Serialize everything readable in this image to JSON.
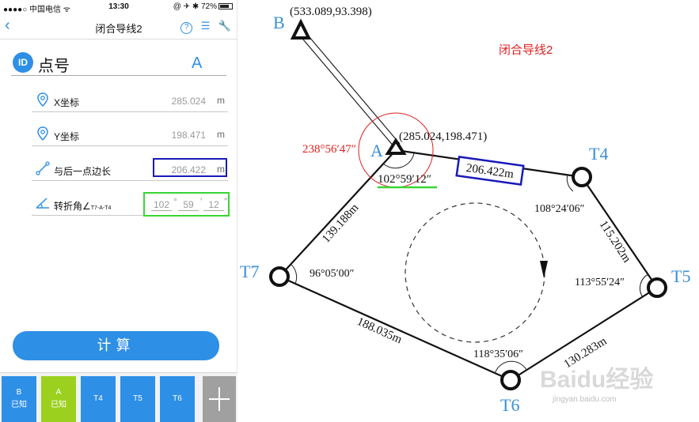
{
  "status": {
    "carrier": "●●●●○ 中国电信 ᯤ",
    "time": "13:30",
    "right": "@ ✈ ✱ 72%",
    "battery_level": 0.72
  },
  "nav": {
    "title": "闭合导线2",
    "back": "‹"
  },
  "point": {
    "badge": "ID",
    "label": "点号",
    "value": "A"
  },
  "fields": {
    "x": {
      "label": "X坐标",
      "value": "285.024",
      "unit": "m"
    },
    "y": {
      "label": "Y坐标",
      "value": "198.471",
      "unit": "m"
    },
    "dist": {
      "label": "与后一点边长",
      "value": "206.422",
      "unit": "m"
    },
    "angle": {
      "label": "转折角∠",
      "label_sub": "T7-A-T4",
      "deg": "102",
      "min": "59",
      "sec": "12"
    }
  },
  "calc": {
    "label": "计算"
  },
  "toolbar": [
    {
      "l1": "B",
      "l2": "已知"
    },
    {
      "l1": "A",
      "l2": "已知"
    },
    {
      "l1": "T4",
      "l2": ""
    },
    {
      "l1": "T5",
      "l2": ""
    },
    {
      "l1": "T6",
      "l2": ""
    }
  ],
  "colors": {
    "accent": "#2e8fe6",
    "active_tab": "#9bd11e",
    "dist_box": "#1a1ab8",
    "angle_box": "#38d634",
    "red": "#e02020"
  },
  "diagram": {
    "title": "闭合导线2",
    "points": {
      "B": {
        "label": "B",
        "coord": "(533.089,93.398)"
      },
      "A": {
        "label": "A",
        "coord": "(285.024,198.471)"
      },
      "T4": {
        "label": "T4"
      },
      "T5": {
        "label": "T5"
      },
      "T6": {
        "label": "T6"
      },
      "T7": {
        "label": "T7"
      }
    },
    "angles": {
      "BA": "238°56′47″",
      "A": "102°59′12″",
      "T4": "108°24′06″",
      "T5": "113°55′24″",
      "T6": "118°35′06″",
      "T7": "96°05′00″"
    },
    "lengths": {
      "A_T4": "206.422m",
      "T4_T5": "115.202m",
      "T5_T6": "130.283m",
      "T6_T7": "188.035m",
      "T7_A": "139.188m"
    },
    "watermark": "Baidu经验",
    "watermark_url": "jingyan.baidu.com"
  }
}
